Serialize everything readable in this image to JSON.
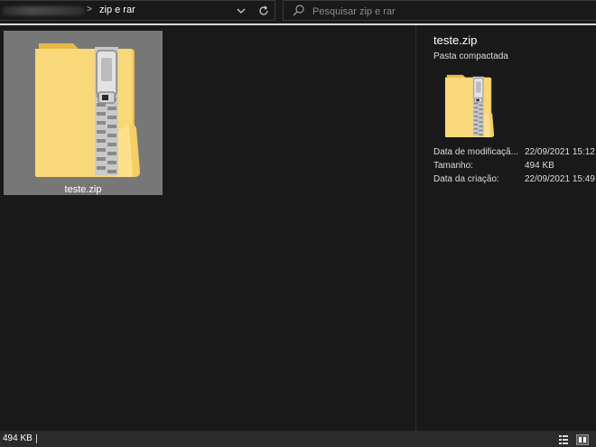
{
  "address_bar": {
    "current_folder": "zip e rar",
    "icons": [
      "chevron-right-icon",
      "chevron-down-icon",
      "refresh-icon"
    ]
  },
  "search": {
    "placeholder": "Pesquisar zip e rar",
    "value": "",
    "icon": "search-icon"
  },
  "files": [
    {
      "name": "teste.zip",
      "icon": "zip-folder-icon",
      "selected": true
    }
  ],
  "details": {
    "title": "teste.zip",
    "type": "Pasta compactada",
    "preview_icon": "zip-folder-icon",
    "properties": [
      {
        "label": "Data de modificaçã...",
        "value": "22/09/2021 15:12"
      },
      {
        "label": "Tamanho:",
        "value": "494 KB"
      },
      {
        "label": "Data da criação:",
        "value": "22/09/2021 15:49"
      }
    ]
  },
  "status_bar": {
    "selection_size": "494 KB",
    "view_buttons": [
      "details-view-icon",
      "tiles-view-icon"
    ]
  },
  "colors": {
    "background": "#191919",
    "selection": "#777777",
    "folder_yellow": "#f7d36a",
    "zipper": "#a9a9a9"
  }
}
